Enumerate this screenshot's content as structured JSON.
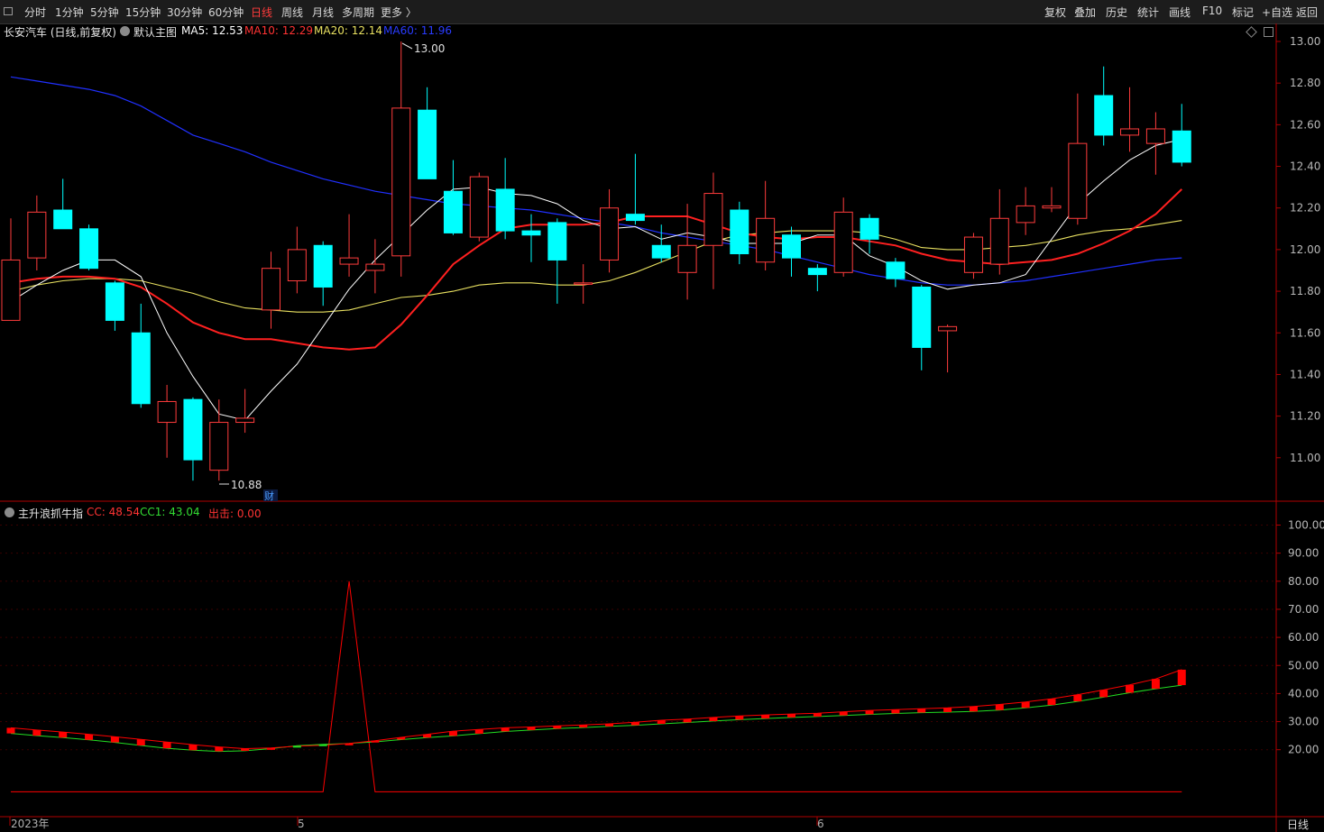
{
  "toolbar": {
    "periods": [
      "分时",
      "1分钟",
      "5分钟",
      "15分钟",
      "30分钟",
      "60分钟",
      "日线",
      "周线",
      "月线",
      "多周期",
      "更多 〉"
    ],
    "active_period": "日线",
    "right_buttons": [
      "复权",
      "叠加",
      "历史",
      "统计",
      "画线",
      "F10",
      "标记",
      "+自选",
      "返回"
    ]
  },
  "main_header": {
    "title": "长安汽车 (日线,前复权)",
    "template": "默认主图",
    "ma5": "MA5: 12.53",
    "ma10": "MA10: 12.29",
    "ma20": "MA20: 12.14",
    "ma60": "MA60: 11.96"
  },
  "indicator_header": {
    "name": "主升浪抓牛指",
    "cc": "CC: 48.54",
    "cc1": "CC1: 43.04",
    "out": "出击: 0.00"
  },
  "annotations": {
    "high_label": "13.00",
    "low_label": "10.88",
    "fin_marker": "财"
  },
  "bottom_right_label": "日线",
  "colors": {
    "up": "#ff3c3c",
    "down": "#00ffff",
    "ma5": "#ffffff",
    "ma10": "#ff2020",
    "ma20": "#e8e060",
    "ma60": "#2030ff",
    "cc": "#ff0000",
    "cc1": "#22dd22",
    "axis": "#b00000"
  },
  "chart_data": [
    {
      "type": "candlestick",
      "title": "长安汽车 (日线,前复权)",
      "y_ticks": [
        13.0,
        12.8,
        12.6,
        12.4,
        12.2,
        12.0,
        11.8,
        11.6,
        11.4,
        11.2,
        11.0
      ],
      "ylim": [
        10.8,
        13.04
      ],
      "x_labels": [
        "2023年",
        "5",
        "6"
      ],
      "candles": [
        {
          "o": 11.66,
          "h": 12.15,
          "l": 11.66,
          "c": 11.95
        },
        {
          "o": 11.96,
          "h": 12.26,
          "l": 11.9,
          "c": 12.18
        },
        {
          "o": 12.19,
          "h": 12.34,
          "l": 12.1,
          "c": 12.1
        },
        {
          "o": 12.1,
          "h": 12.12,
          "l": 11.9,
          "c": 11.91
        },
        {
          "o": 11.84,
          "h": 11.85,
          "l": 11.61,
          "c": 11.66
        },
        {
          "o": 11.6,
          "h": 11.74,
          "l": 11.24,
          "c": 11.26
        },
        {
          "o": 11.17,
          "h": 11.35,
          "l": 11.0,
          "c": 11.27
        },
        {
          "o": 11.28,
          "h": 11.29,
          "l": 10.89,
          "c": 10.99
        },
        {
          "o": 10.94,
          "h": 11.28,
          "l": 10.89,
          "c": 11.17
        },
        {
          "o": 11.17,
          "h": 11.33,
          "l": 11.12,
          "c": 11.19
        },
        {
          "o": 11.71,
          "h": 11.99,
          "l": 11.62,
          "c": 11.91
        },
        {
          "o": 11.85,
          "h": 12.11,
          "l": 11.79,
          "c": 12.0
        },
        {
          "o": 12.02,
          "h": 12.04,
          "l": 11.73,
          "c": 11.82
        },
        {
          "o": 11.93,
          "h": 12.17,
          "l": 11.87,
          "c": 11.96
        },
        {
          "o": 11.9,
          "h": 12.05,
          "l": 11.79,
          "c": 11.93
        },
        {
          "o": 11.97,
          "h": 13.0,
          "l": 11.87,
          "c": 12.68
        },
        {
          "o": 12.67,
          "h": 12.78,
          "l": 12.34,
          "c": 12.34
        },
        {
          "o": 12.28,
          "h": 12.43,
          "l": 12.07,
          "c": 12.08
        },
        {
          "o": 12.06,
          "h": 12.37,
          "l": 12.04,
          "c": 12.35
        },
        {
          "o": 12.29,
          "h": 12.44,
          "l": 12.05,
          "c": 12.09
        },
        {
          "o": 12.09,
          "h": 12.17,
          "l": 11.94,
          "c": 12.07
        },
        {
          "o": 12.13,
          "h": 12.15,
          "l": 11.74,
          "c": 11.95
        },
        {
          "o": 11.84,
          "h": 11.93,
          "l": 11.74,
          "c": 11.84
        },
        {
          "o": 11.95,
          "h": 12.29,
          "l": 11.89,
          "c": 12.2
        },
        {
          "o": 12.17,
          "h": 12.46,
          "l": 12.12,
          "c": 12.14
        },
        {
          "o": 12.02,
          "h": 12.12,
          "l": 11.94,
          "c": 11.96
        },
        {
          "o": 11.89,
          "h": 12.22,
          "l": 11.76,
          "c": 12.02
        },
        {
          "o": 12.02,
          "h": 12.37,
          "l": 11.81,
          "c": 12.27
        },
        {
          "o": 12.19,
          "h": 12.23,
          "l": 11.93,
          "c": 11.98
        },
        {
          "o": 11.94,
          "h": 12.33,
          "l": 11.9,
          "c": 12.15
        },
        {
          "o": 12.07,
          "h": 12.11,
          "l": 11.87,
          "c": 11.96
        },
        {
          "o": 11.91,
          "h": 11.93,
          "l": 11.8,
          "c": 11.88
        },
        {
          "o": 11.89,
          "h": 12.25,
          "l": 11.87,
          "c": 12.18
        },
        {
          "o": 12.15,
          "h": 12.17,
          "l": 11.98,
          "c": 12.05
        },
        {
          "o": 11.94,
          "h": 11.96,
          "l": 11.82,
          "c": 11.86
        },
        {
          "o": 11.82,
          "h": 11.83,
          "l": 11.42,
          "c": 11.53
        },
        {
          "o": 11.61,
          "h": 11.64,
          "l": 11.41,
          "c": 11.63
        },
        {
          "o": 11.89,
          "h": 12.08,
          "l": 11.86,
          "c": 12.06
        },
        {
          "o": 11.93,
          "h": 12.29,
          "l": 11.88,
          "c": 12.15
        },
        {
          "o": 12.13,
          "h": 12.3,
          "l": 12.07,
          "c": 12.21
        },
        {
          "o": 12.2,
          "h": 12.3,
          "l": 12.18,
          "c": 12.21
        },
        {
          "o": 12.15,
          "h": 12.75,
          "l": 12.12,
          "c": 12.51
        },
        {
          "o": 12.74,
          "h": 12.88,
          "l": 12.5,
          "c": 12.55
        },
        {
          "o": 12.55,
          "h": 12.78,
          "l": 12.47,
          "c": 12.58
        },
        {
          "o": 12.51,
          "h": 12.66,
          "l": 12.36,
          "c": 12.58
        },
        {
          "o": 12.57,
          "h": 12.7,
          "l": 12.4,
          "c": 12.42
        }
      ],
      "series": [
        {
          "name": "MA5",
          "values": [
            11.75,
            11.83,
            11.9,
            11.95,
            11.95,
            11.87,
            11.6,
            11.39,
            11.21,
            11.18,
            11.32,
            11.45,
            11.63,
            11.81,
            11.95,
            12.07,
            12.19,
            12.29,
            12.3,
            12.27,
            12.26,
            12.22,
            12.14,
            12.1,
            12.11,
            12.05,
            12.08,
            12.06,
            12.03,
            12.03,
            12.03,
            12.07,
            12.07,
            11.97,
            11.92,
            11.85,
            11.81,
            11.83,
            11.84,
            11.88,
            12.05,
            12.22,
            12.33,
            12.43,
            12.5,
            12.53
          ]
        },
        {
          "name": "MA10",
          "values": [
            11.84,
            11.86,
            11.87,
            11.87,
            11.86,
            11.82,
            11.74,
            11.65,
            11.6,
            11.57,
            11.57,
            11.55,
            11.53,
            11.52,
            11.53,
            11.64,
            11.78,
            11.93,
            12.02,
            12.1,
            12.12,
            12.12,
            12.12,
            12.13,
            12.16,
            12.16,
            12.16,
            12.12,
            12.08,
            12.06,
            12.05,
            12.06,
            12.06,
            12.04,
            12.02,
            11.98,
            11.95,
            11.94,
            11.93,
            11.94,
            11.95,
            11.98,
            12.03,
            12.09,
            12.17,
            12.29
          ]
        },
        {
          "name": "MA20",
          "values": [
            11.8,
            11.83,
            11.85,
            11.86,
            11.86,
            11.85,
            11.82,
            11.79,
            11.75,
            11.72,
            11.71,
            11.7,
            11.7,
            11.71,
            11.74,
            11.77,
            11.78,
            11.8,
            11.83,
            11.84,
            11.84,
            11.83,
            11.83,
            11.85,
            11.89,
            11.94,
            11.99,
            12.04,
            12.07,
            12.08,
            12.09,
            12.09,
            12.09,
            12.08,
            12.05,
            12.01,
            12.0,
            12.0,
            12.01,
            12.02,
            12.04,
            12.07,
            12.09,
            12.1,
            12.12,
            12.14
          ]
        },
        {
          "name": "MA60",
          "values": [
            12.83,
            12.81,
            12.79,
            12.77,
            12.74,
            12.69,
            12.62,
            12.55,
            12.51,
            12.47,
            12.42,
            12.38,
            12.34,
            12.31,
            12.28,
            12.26,
            12.24,
            12.22,
            12.21,
            12.2,
            12.19,
            12.17,
            12.15,
            12.13,
            12.11,
            12.08,
            12.06,
            12.04,
            12.02,
            12.0,
            11.97,
            11.94,
            11.91,
            11.88,
            11.86,
            11.84,
            11.83,
            11.83,
            11.84,
            11.85,
            11.87,
            11.89,
            11.91,
            11.93,
            11.95,
            11.96
          ]
        }
      ]
    },
    {
      "type": "line",
      "title": "主升浪抓牛指",
      "y_ticks": [
        100.0,
        90.0,
        80.0,
        70.0,
        60.0,
        50.0,
        40.0,
        30.0,
        20.0
      ],
      "ylim": [
        4,
        104
      ],
      "series": [
        {
          "name": "CC",
          "values": [
            27.8,
            27.0,
            26.3,
            25.5,
            24.6,
            23.7,
            22.7,
            21.8,
            21.0,
            20.4,
            20.6,
            21.3,
            21.6,
            22.2,
            23.2,
            24.4,
            25.5,
            26.6,
            27.2,
            27.8,
            28.1,
            28.5,
            28.8,
            29.2,
            29.8,
            30.5,
            30.9,
            31.5,
            32.0,
            32.4,
            32.7,
            33.0,
            33.5,
            34.0,
            34.3,
            34.6,
            34.9,
            35.4,
            36.1,
            37.0,
            38.1,
            39.6,
            41.3,
            43.1,
            45.2,
            48.5
          ]
        },
        {
          "name": "CC1",
          "values": [
            25.8,
            25.0,
            24.3,
            23.5,
            22.6,
            21.5,
            20.5,
            19.8,
            19.4,
            19.6,
            20.4,
            21.4,
            21.9,
            22.2,
            22.8,
            23.6,
            24.3,
            24.9,
            25.7,
            26.5,
            27.0,
            27.5,
            27.9,
            28.3,
            28.7,
            29.2,
            29.7,
            30.2,
            30.7,
            31.1,
            31.5,
            31.8,
            32.2,
            32.6,
            32.9,
            33.2,
            33.4,
            33.6,
            34.1,
            34.9,
            35.9,
            37.2,
            38.7,
            40.3,
            41.7,
            43.0
          ]
        },
        {
          "name": "出击",
          "values": [
            0,
            0,
            0,
            0,
            0,
            0,
            0,
            0,
            0,
            0,
            0,
            0,
            0,
            80,
            0,
            0,
            0,
            0,
            0,
            0,
            0,
            0,
            0,
            0,
            0,
            0,
            0,
            0,
            0,
            0,
            0,
            0,
            0,
            0,
            0,
            0,
            0,
            0,
            0,
            0,
            0,
            0,
            0,
            0,
            0,
            0
          ]
        }
      ]
    }
  ]
}
